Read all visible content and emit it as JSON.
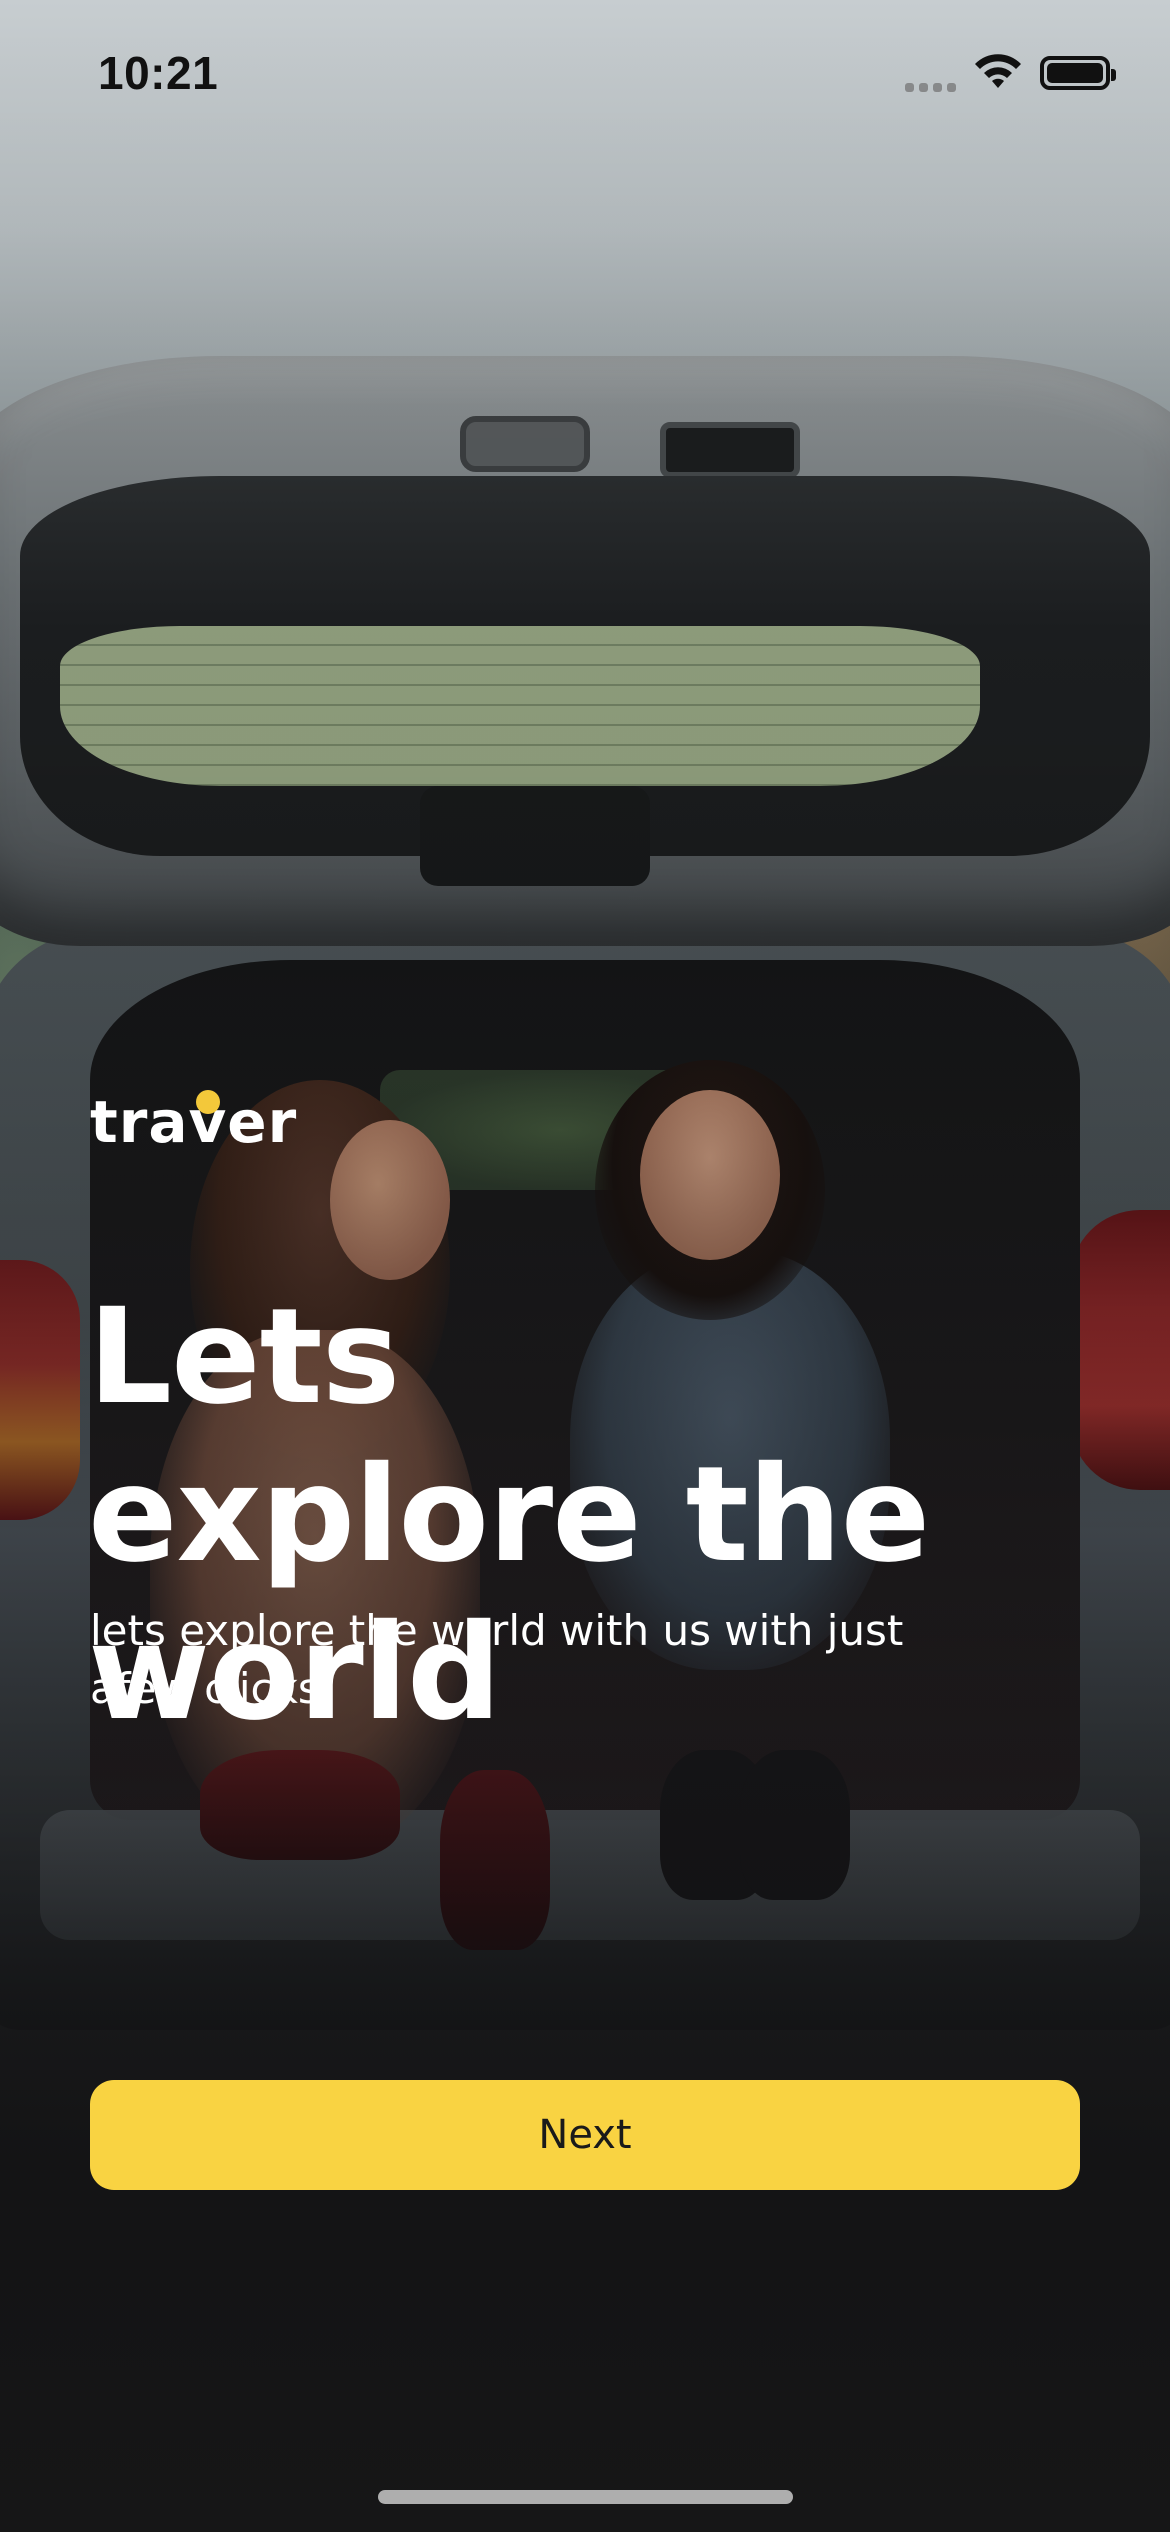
{
  "status_bar": {
    "time": "10:21",
    "icons": [
      "signal-dots-icon",
      "wifi-icon",
      "battery-icon"
    ]
  },
  "brand": {
    "name": "traver",
    "accent_color": "#f3c83a"
  },
  "hero": {
    "title": "Lets explore the world",
    "subtitle": "lets explore the world with us with just afew clicks"
  },
  "actions": {
    "next_label": "Next",
    "button_color": "#f9d342"
  }
}
